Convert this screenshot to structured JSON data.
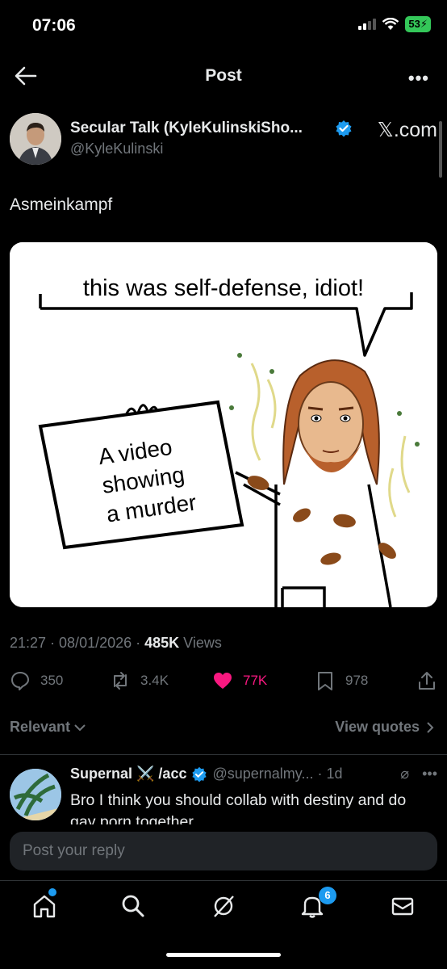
{
  "status": {
    "time": "07:06",
    "battery": "53"
  },
  "header": {
    "title": "Post"
  },
  "author": {
    "name": "Secular Talk (KyleKulinskiSho...",
    "handle": "@KyleKulinski",
    "source": "𝕏.com"
  },
  "post": {
    "text": "Asmeinkampf",
    "image": {
      "speech": "this was self-defense, idiot!",
      "sign_line1": "A video",
      "sign_line2": "showing",
      "sign_line3": "a murder"
    },
    "time": "21:27 · 08/01/2026 · ",
    "views_count": "485K",
    "views_label": " Views"
  },
  "actions": {
    "replies": "350",
    "reposts": "3.4K",
    "likes": "77K",
    "bookmarks": "978"
  },
  "filters": {
    "sort": "Relevant",
    "quotes": "View quotes"
  },
  "reply": {
    "name": "Supernal ⚔️ /acc",
    "handle": "@supernalmy... · 1d",
    "text": "Bro I think you should collab with destiny and do gay porn together"
  },
  "compose": {
    "placeholder": "Post your reply"
  },
  "tabbar": {
    "notifications_badge": "6"
  },
  "colors": {
    "accent": "#1d9bf0",
    "like": "#f91880",
    "background": "#000000"
  }
}
